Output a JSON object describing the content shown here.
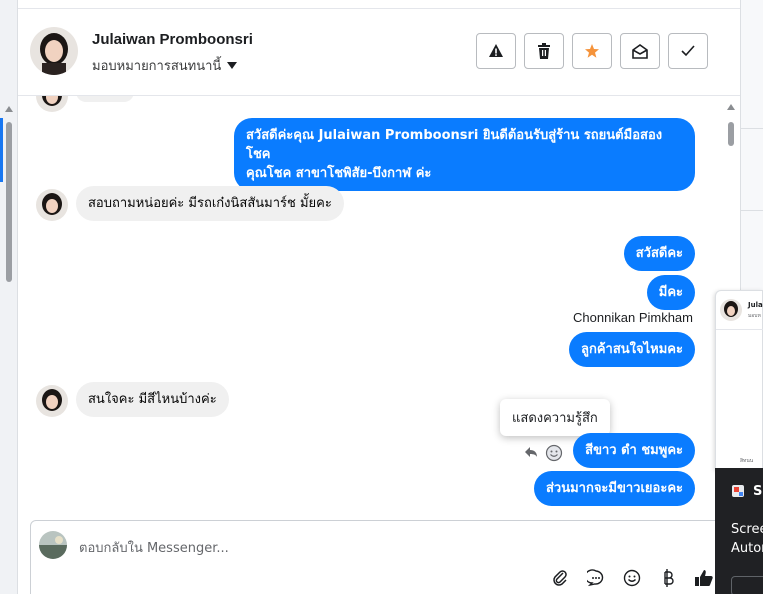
{
  "header": {
    "contact_name": "Julaiwan Promboonsri",
    "assign_label": "มอบหมายการสนทนานี้",
    "actions": [
      {
        "name": "report-button",
        "icon": "warning-icon"
      },
      {
        "name": "delete-button",
        "icon": "trash-icon"
      },
      {
        "name": "follow-up-button",
        "icon": "star-icon"
      },
      {
        "name": "mark-unread-button",
        "icon": "envelope-open-icon"
      },
      {
        "name": "mark-done-button",
        "icon": "check-icon"
      }
    ]
  },
  "messages": {
    "m1": "สวัสดีค่ะคุณ Julaiwan Promboonsri ยินดีต้อนรับสู่ร้าน รถยนต์มือสอง โชค",
    "m1b": "คุณโชค สาขาโชพิสัย-บึงกาฬ ค่ะ",
    "m2": "สอบถามหน่อยค่ะ มีรถเก๋งนิสสันมาร์ช มั้ยคะ",
    "m3": "สวัสดีคะ",
    "m4": "มีคะ",
    "sender": "Chonnikan Pimkham",
    "m5": "ลูกค้าสนใจไหมคะ",
    "m6": "สนใจคะ มีสีไหนบ้างค่ะ",
    "tooltip": "แสดงความรู้สึก",
    "m7": "สีขาว ดำ ชมพูคะ",
    "m8": "ส่วนมากจะมีขาวเยอะคะ"
  },
  "composer": {
    "placeholder": "ตอบกลับใน Messenger..."
  },
  "side_popup": {
    "name": "Jula",
    "sub": "มอบห",
    "footer": "สิทนน"
  },
  "toast": {
    "title": "S",
    "line1": "Scree",
    "line2": "Autor"
  },
  "colors": {
    "outgoing_bubble": "#0a7cff",
    "incoming_bubble": "#f0f0f0",
    "star": "#f5933b"
  }
}
